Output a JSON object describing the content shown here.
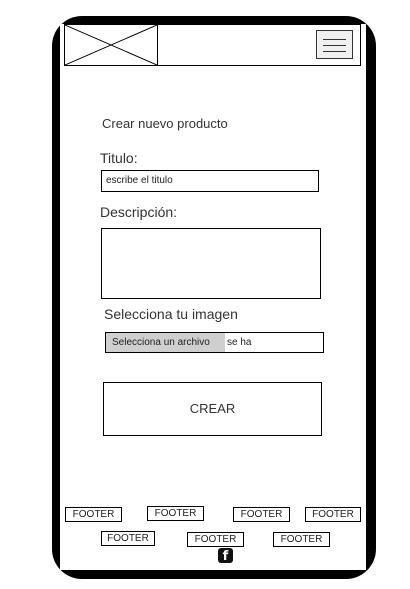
{
  "form": {
    "heading": "Crear nuevo producto",
    "title_label": "Titulo:",
    "title_value": "escribe el titulo",
    "description_label": "Descripción:",
    "image_label": "Selecciona tu imagen",
    "file_button_label": "Selecciona un archivo",
    "file_status": "se ha",
    "submit_label": "CREAR"
  },
  "footer": {
    "row1": [
      "FOOTER",
      "FOOTER",
      "FOOTER",
      "FOOTER"
    ],
    "row2": [
      "FOOTER",
      "FOOTER",
      "FOOTER"
    ]
  },
  "icons": {
    "logo": "image-placeholder-icon",
    "menu": "hamburger-menu-icon",
    "social": "facebook-icon"
  }
}
